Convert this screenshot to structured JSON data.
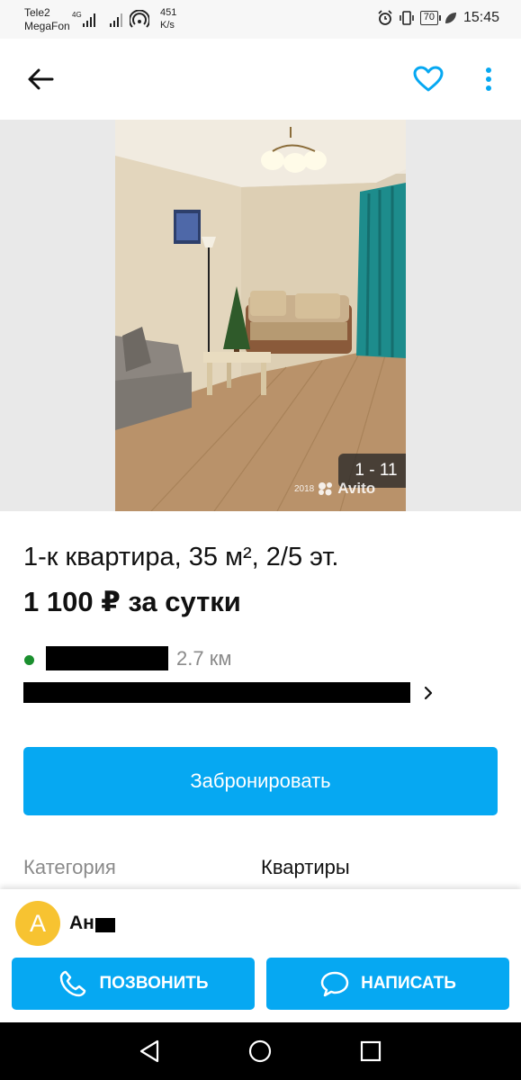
{
  "status_bar": {
    "carrier1": "Tele2",
    "carrier2": "MegaFon",
    "network": "4G",
    "speed_value": "451",
    "speed_unit": "K/s",
    "battery": "70",
    "time": "15:45"
  },
  "app_bar": {
    "back_icon": "arrow-left-icon",
    "favorite_icon": "heart-outline-icon",
    "more_icon": "vertical-dots-icon"
  },
  "gallery": {
    "counter": "1 - 11",
    "watermark_year": "2018",
    "watermark_brand": "Avito"
  },
  "listing": {
    "title": "1-к квартира, 35 м², 2/5 эт.",
    "price": "1 100 ₽ за сутки",
    "distance": "2.7 км",
    "book_label": "Забронировать",
    "param_label": "Категория",
    "param_value": "Квартиры"
  },
  "seller": {
    "avatar_letter": "А",
    "name": "Ан"
  },
  "actions": {
    "call_label": "ПОЗВОНИТЬ",
    "message_label": "НАПИСАТЬ"
  },
  "colors": {
    "accent": "#06a8f2",
    "metro": "#1a8f2e",
    "avatar": "#f7c331",
    "secondary_text": "#8a8a8a"
  }
}
